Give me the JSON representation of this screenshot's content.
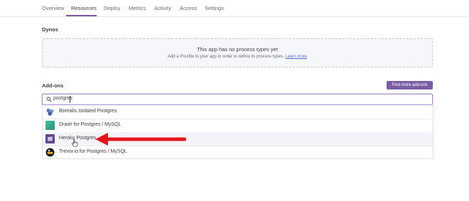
{
  "nav": {
    "tabs": [
      {
        "label": "Overview"
      },
      {
        "label": "Resources"
      },
      {
        "label": "Deploy"
      },
      {
        "label": "Metrics"
      },
      {
        "label": "Activity"
      },
      {
        "label": "Access"
      },
      {
        "label": "Settings"
      }
    ],
    "active_tab": "Resources"
  },
  "dynos": {
    "heading": "Dynos",
    "empty_title": "This app has no process types yet",
    "empty_text": "Add a Procfile to your app in order to define its process types.",
    "learn_more": "Learn more"
  },
  "addons": {
    "heading": "Add-ons",
    "find_button": "Find more add-ons",
    "search_value": "postgres",
    "results": [
      {
        "label": "Borealis Isolated Postgres",
        "icon": "borealis-icon"
      },
      {
        "label": "Draxlr for Postgres / MySQL",
        "icon": "draxlr-icon"
      },
      {
        "label": "Heroku Postgres",
        "icon": "heroku-postgres-icon"
      },
      {
        "label": "Trevor.io for Postgres / MySQL",
        "icon": "trevor-icon"
      }
    ]
  },
  "colors": {
    "accent": "#79589f",
    "button": "#7a5ea5",
    "annotation_arrow": "#e3161e"
  }
}
